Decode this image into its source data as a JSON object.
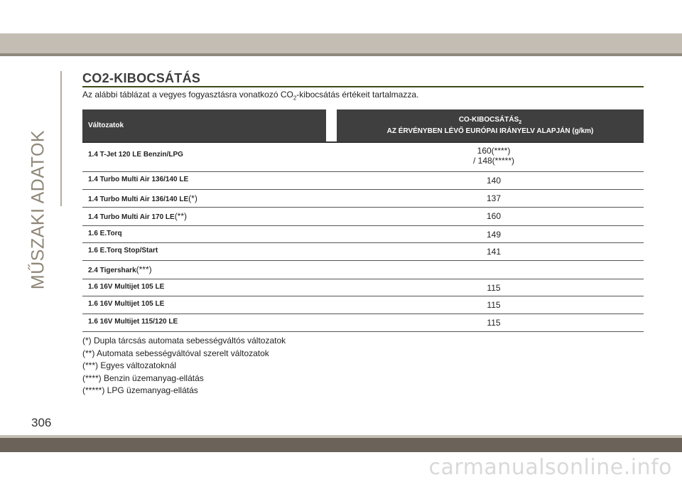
{
  "side_label": "MŰSZAKI ADATOK",
  "heading": "CO2-KIBOCSÁTÁS",
  "intro": {
    "before": "Az alábbi táblázat a vegyes fogyasztásra vonatkozó CO",
    "sub": "2",
    "after": "-kibocsátás értékeit tartalmazza."
  },
  "table": {
    "header_left": "Változatok",
    "header_right_line1": "CO-KIBOCSÁTÁS",
    "header_right_sub": "2",
    "header_right_line2": "AZ ÉRVÉNYBEN LÉVŐ EURÓPAI IRÁNYELV ALAPJÁN (g/km)",
    "rows": [
      {
        "name": "1.4 T-Jet 120 LE Benzin/LPG",
        "sup": "",
        "value": "160(****)",
        "value2": "/ 148(*****)"
      },
      {
        "name": "1.4 Turbo Multi Air 136/140 LE",
        "sup": "",
        "value": "140",
        "value2": ""
      },
      {
        "name": "1.4 Turbo Multi Air 136/140 LE",
        "sup": "(*)",
        "value": "137",
        "value2": ""
      },
      {
        "name": "1.4 Turbo Multi Air 170 LE",
        "sup": "(**)",
        "value": "160",
        "value2": ""
      },
      {
        "name": "1.6 E.Torq",
        "sup": "",
        "value": "149",
        "value2": ""
      },
      {
        "name": "1.6 E.Torq Stop/Start",
        "sup": "",
        "value": "141",
        "value2": ""
      },
      {
        "name": "2.4 Tigershark",
        "sup": "(***)",
        "value": "",
        "value2": ""
      },
      {
        "name": "1.6 16V Multijet 105 LE",
        "sup": "",
        "value": "115",
        "value2": ""
      },
      {
        "name": "1.6 16V Multijet 105 LE",
        "sup": "",
        "value": "115",
        "value2": ""
      },
      {
        "name": "1.6 16V Multijet 115/120 LE",
        "sup": "",
        "value": "115",
        "value2": ""
      }
    ]
  },
  "notes": [
    "(*) Dupla tárcsás automata sebességváltós változatok",
    "(**) Automata sebességváltóval szerelt változatok",
    "(***) Egyes változatoknál",
    "(****) Benzin üzemanyag-ellátás",
    "(*****) LPG üzemanyag-ellátás"
  ],
  "page_number": "306",
  "watermark": "carmanualsonline.info"
}
